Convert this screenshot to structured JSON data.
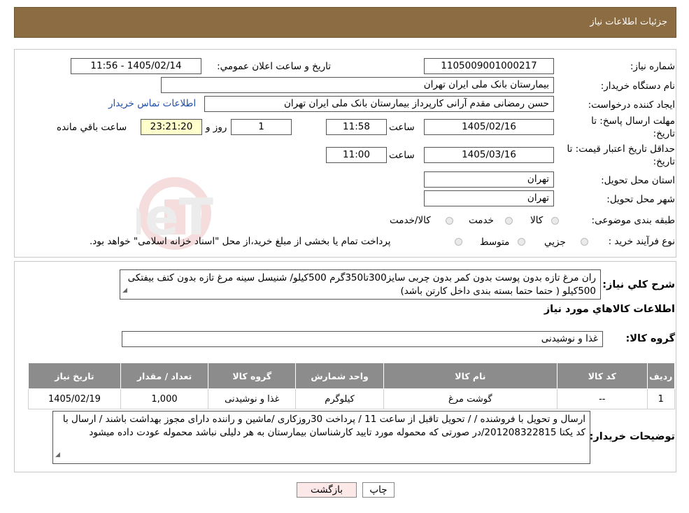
{
  "header": {
    "title": "جزئیات اطلاعات نیاز"
  },
  "form": {
    "need_number_label": "شماره نیاز:",
    "need_number": "1105009001000217",
    "announce_label": "تاریخ و ساعت اعلان عمومي:",
    "announce_value": "1405/02/14 - 11:56",
    "buyer_org_label": "نام دستگاه خريدار:",
    "buyer_org": "بیمارستان بانک ملی ایران تهران",
    "creator_label": "ايجاد کننده درخواست:",
    "creator": "حسن رمضانی مقدم آرانی کارپرداز بیمارستان بانک ملی ایران تهران",
    "contact_link": "اطلاعات تماس خريدار",
    "deadline_label": "مهلت ارسال پاسخ: تا تاريخ:",
    "deadline_date": "1405/02/16",
    "time_label": "ساعت",
    "deadline_time": "11:58",
    "days_value": "1",
    "days_label": "روز و",
    "remaining_time": "23:21:20",
    "remaining_label": "ساعت باقي مانده",
    "validity_label": "حداقل تاريخ اعتبار قيمت: تا تاريخ:",
    "validity_date": "1405/03/16",
    "validity_time": "11:00",
    "province_label": "استان محل تحويل:",
    "province": "تهران",
    "city_label": "شهر محل تحويل:",
    "city": "تهران",
    "category_label": "طبقه بندی موضوعی:",
    "category_options": [
      "کالا",
      "خدمت",
      "کالا/خدمت"
    ],
    "process_label": "نوع فرآيند خريد :",
    "process_options": [
      "جزيي",
      "متوسط"
    ],
    "process_note": "پرداخت تمام یا بخشی از مبلغ خرید،از محل \"اسناد خزانه اسلامی\" خواهد بود."
  },
  "description": {
    "label": "شرح کلي نياز:",
    "text": "ران مرغ تازه بدون پوست بدون کمر بدون چربی سایز300تا350گرم 500کیلو/ شنیسل سینه مرغ تازه بدون کتف بیفتکی 500کیلو ( حتما حتما بسته بندی داخل کارتن باشد)"
  },
  "goods": {
    "section_title": "اطلاعات کالاهاي مورد نياز",
    "group_label": "گروه کالا:",
    "group_value": "غذا و نوشیدنی",
    "columns": [
      "رديف",
      "کد کالا",
      "نام کالا",
      "واحد شمارش",
      "گروه کالا",
      "تعداد / مقدار",
      "تاريخ نياز"
    ],
    "rows": [
      [
        "1",
        "--",
        "گوشت مرغ",
        "کیلوگرم",
        "غذا و نوشیدنی",
        "1,000",
        "1405/02/19"
      ]
    ]
  },
  "buyer_notes": {
    "label": "توضيحات خريدار:",
    "text": "ارسال و تحویل با فروشنده / / تحویل تاقبل از ساعت 11 / پرداخت 30روزکاری /ماشین و راننده دارای مجوز بهداشت باشند / ارسال با کد یکتا 201208322815/در صورتی که محموله مورد تایید کارشناسان بیمارستان به هر دلیلی نباشد محموله عودت داده میشود"
  },
  "buttons": {
    "print": "چاپ",
    "back": "بازگشت"
  },
  "watermark": "AriaTender.neT",
  "colors": {
    "header": "#8b6c43",
    "table_header": "#8c8c8c",
    "yellow_field": "#ffffcc",
    "link": "#1f4fa8"
  }
}
